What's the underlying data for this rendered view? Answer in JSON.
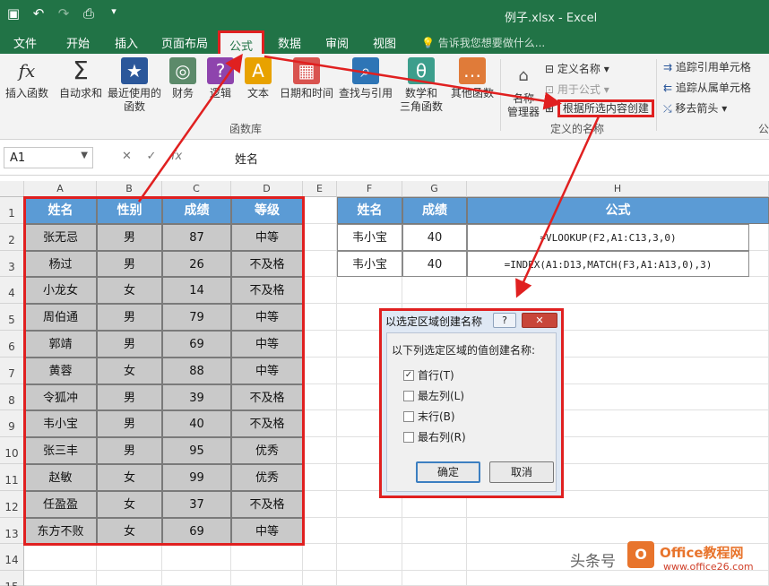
{
  "titlebar": {
    "title": "例子.xlsx - Excel",
    "qat": [
      "save-icon",
      "undo-icon",
      "redo-icon",
      "print-preview-icon",
      "customize-icon"
    ]
  },
  "tabs": [
    "文件",
    "开始",
    "插入",
    "页面布局",
    "公式",
    "数据",
    "审阅",
    "视图"
  ],
  "active_tab": "公式",
  "tell_me": "告诉我您想要做什么...",
  "ribbon": {
    "insert_function": "插入函数",
    "autosum_l1": "自动求和",
    "recent_l1": "最近使用的",
    "recent_l2": "函数",
    "finance": "财务",
    "logic": "逻辑",
    "text": "文本",
    "datetime": "日期和时间",
    "lookup": "查找与引用",
    "math_l1": "数学和",
    "math_l2": "三角函数",
    "other": "其他函数",
    "group_library": "函数库",
    "name_mgr_l1": "名称",
    "name_mgr_l2": "管理器",
    "define_name": "定义名称",
    "use_in_formula": "用于公式",
    "create_from_sel": "根据所选内容创建",
    "group_defined": "定义的名称",
    "trace_prec": "追踪引用单元格",
    "trace_dep": "追踪从属单元格",
    "remove_arrows": "移去箭头",
    "group_audit": "公",
    "colors": {
      "accent": "#217346",
      "highlight": "#e02020"
    }
  },
  "formula_bar": {
    "name_box": "A1",
    "content": "姓名",
    "fx": "fx"
  },
  "grid": {
    "col_headers": [
      "A",
      "B",
      "C",
      "D",
      "E",
      "F",
      "G",
      "H"
    ],
    "row_headers": [
      "1",
      "2",
      "3",
      "4",
      "5",
      "6",
      "7",
      "8",
      "9",
      "10",
      "11",
      "12",
      "13",
      "14",
      "15"
    ],
    "table1": {
      "headers": [
        "姓名",
        "性别",
        "成绩",
        "等级"
      ],
      "rows": [
        [
          "张无忌",
          "男",
          "87",
          "中等"
        ],
        [
          "杨过",
          "男",
          "26",
          "不及格"
        ],
        [
          "小龙女",
          "女",
          "14",
          "不及格"
        ],
        [
          "周伯通",
          "男",
          "79",
          "中等"
        ],
        [
          "郭靖",
          "男",
          "69",
          "中等"
        ],
        [
          "黄蓉",
          "女",
          "88",
          "中等"
        ],
        [
          "令狐冲",
          "男",
          "39",
          "不及格"
        ],
        [
          "韦小宝",
          "男",
          "40",
          "不及格"
        ],
        [
          "张三丰",
          "男",
          "95",
          "优秀"
        ],
        [
          "赵敏",
          "女",
          "99",
          "优秀"
        ],
        [
          "任盈盈",
          "女",
          "37",
          "不及格"
        ],
        [
          "东方不败",
          "女",
          "69",
          "中等"
        ]
      ]
    },
    "table2": {
      "headers": [
        "姓名",
        "成绩",
        "公式"
      ],
      "rows": [
        [
          "韦小宝",
          "40",
          "=VLOOKUP(F2,A1:C13,3,0)"
        ],
        [
          "韦小宝",
          "40",
          "=INDEX(A1:D13,MATCH(F3,A1:A13,0),3)"
        ]
      ]
    }
  },
  "dialog": {
    "title": "以选定区域创建名称",
    "help": "?",
    "close": "✕",
    "prompt": "以下列选定区域的值创建名称:",
    "options": [
      {
        "label": "首行(T)",
        "checked": true
      },
      {
        "label": "最左列(L)",
        "checked": false
      },
      {
        "label": "末行(B)",
        "checked": false
      },
      {
        "label": "最右列(R)",
        "checked": false
      }
    ],
    "ok": "确定",
    "cancel": "取消"
  },
  "watermark": {
    "text": "头条号",
    "logo": "O",
    "brand": "Office教程网",
    "url": "www.office26.com"
  }
}
